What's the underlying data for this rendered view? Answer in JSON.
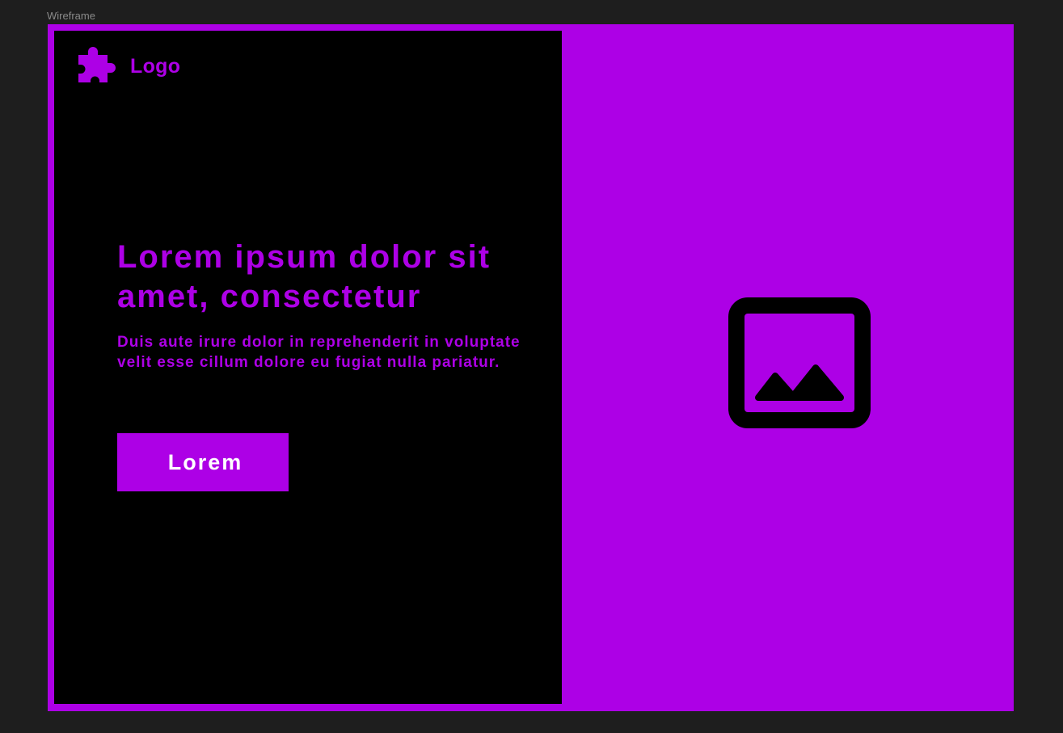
{
  "canvas": {
    "frame_label": "Wireframe"
  },
  "wireframe": {
    "logo": {
      "icon": "puzzle-piece-icon",
      "text": "Logo"
    },
    "hero": {
      "headline": "Lorem ipsum dolor sit amet, consectetur",
      "subtext": "Duis aute irure dolor in reprehenderit in voluptate velit esse cillum dolore eu fugiat nulla pariatur.",
      "button_label": "Lorem"
    },
    "media": {
      "icon": "image-placeholder-icon"
    }
  },
  "colors": {
    "accent": "#ad00e6",
    "panel": "#000000",
    "canvas_background": "#1e1e1e",
    "button_text": "#ffffff"
  }
}
